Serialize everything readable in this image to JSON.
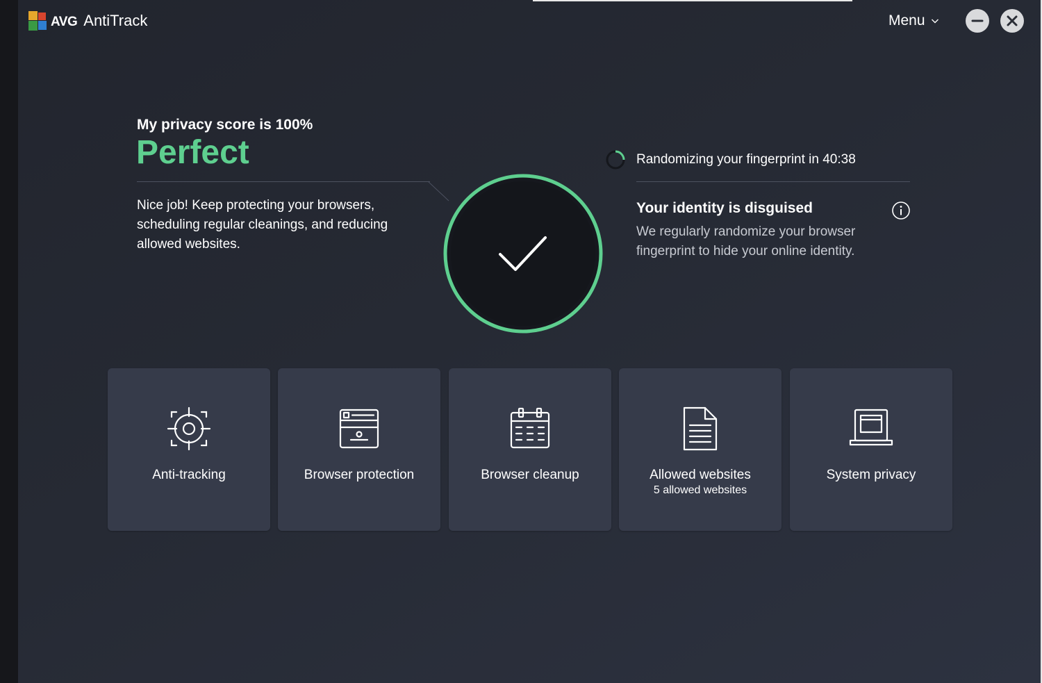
{
  "app": {
    "brand": "AVG",
    "name": "AntiTrack",
    "menu_label": "Menu"
  },
  "colors": {
    "accent_green": "#5ecf8f",
    "tile_bg": "#363b4a",
    "window_bg": "#262a34"
  },
  "privacy": {
    "heading": "My privacy score is 100%",
    "status": "Perfect",
    "description": "Nice job! Keep protecting your browsers, scheduling regular cleanings, and reducing allowed websites."
  },
  "fingerprint": {
    "status": "Randomizing your fingerprint in 40:38",
    "title": "Your identity is disguised",
    "description": "We regularly randomize your browser fingerprint to hide your online identity."
  },
  "tiles": [
    {
      "label": "Anti-tracking",
      "icon": "crosshair-icon"
    },
    {
      "label": "Browser protection",
      "icon": "browser-window-icon"
    },
    {
      "label": "Browser cleanup",
      "icon": "calendar-icon"
    },
    {
      "label": "Allowed websites",
      "sublabel": "5 allowed websites",
      "icon": "document-icon"
    },
    {
      "label": "System privacy",
      "icon": "laptop-icon"
    }
  ]
}
